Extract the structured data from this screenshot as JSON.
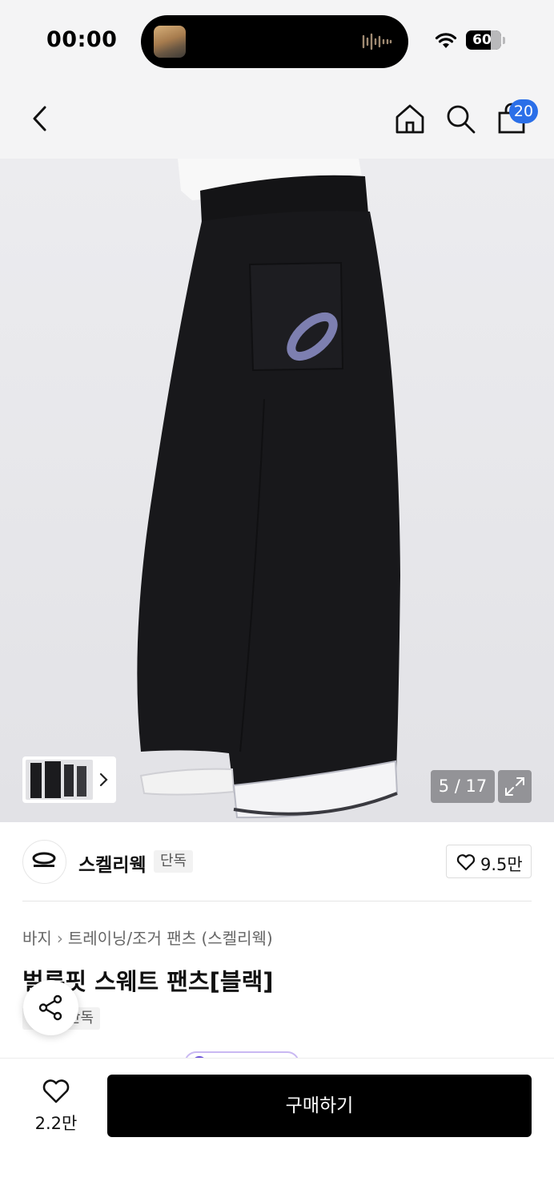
{
  "status_bar": {
    "time": "00:00",
    "battery": "60",
    "icons": [
      "music-art-icon",
      "audio-wave-icon",
      "wifi-icon",
      "battery-icon"
    ]
  },
  "nav": {
    "icons": [
      "back-arrow-icon",
      "home-icon",
      "search-icon",
      "cart-icon"
    ],
    "cart_count": "20"
  },
  "gallery": {
    "counter": "5 / 17",
    "icons": [
      "thumbnail-next-icon",
      "expand-icon"
    ]
  },
  "brand": {
    "name": "스켈리웩",
    "tag": "단독",
    "like_count": "9.5만",
    "logo_icon": "brand-logo-icon"
  },
  "product": {
    "breadcrumb": [
      "바지",
      "트레이닝/조거 팬츠 (스켈리웩)"
    ],
    "title": "벌룬핏 스웨트 팬츠[블랙]",
    "tag": "단독"
  },
  "bottom_bar": {
    "like_count": "2.2만",
    "buy_label": "구매하기"
  },
  "colors": {
    "accent_badge": "#2b6fe8",
    "buy_button": "#000000",
    "status_bg": "#f4f4f5"
  }
}
